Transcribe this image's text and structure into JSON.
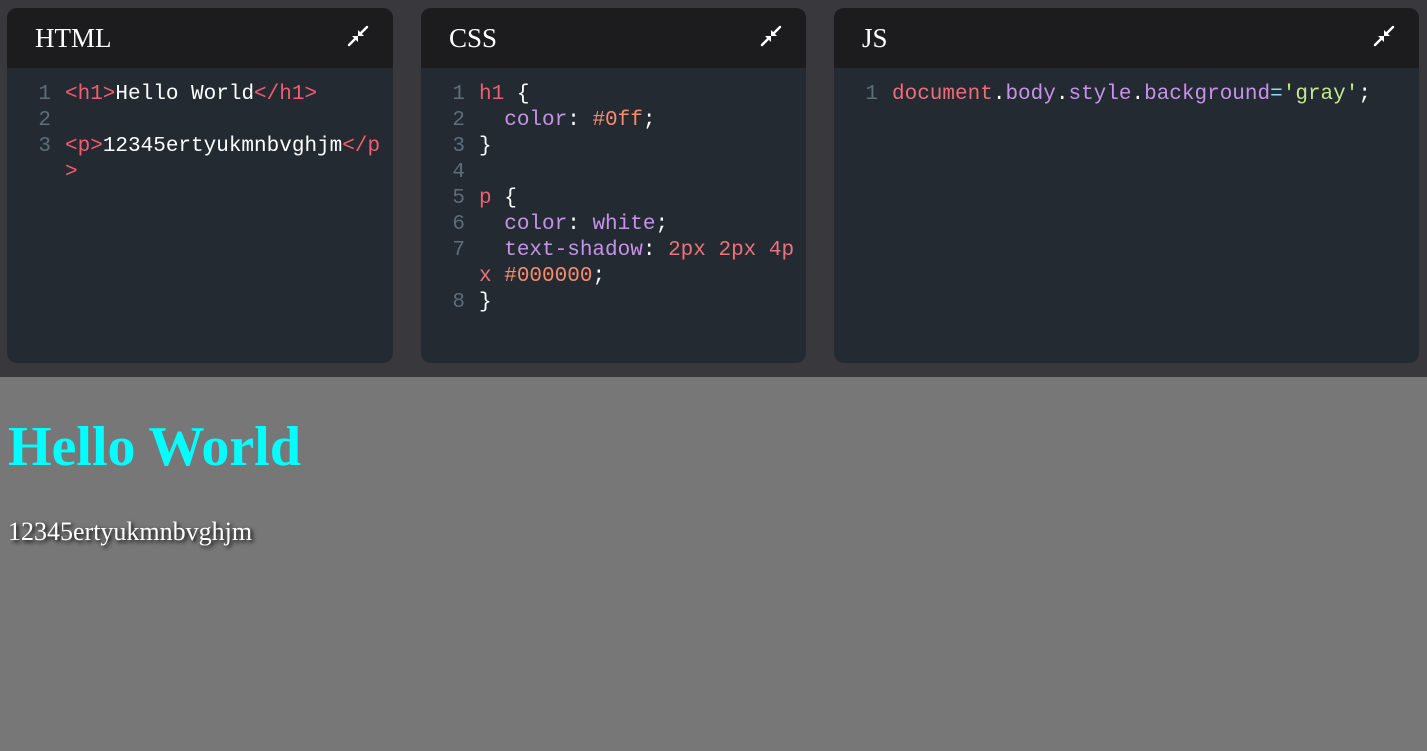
{
  "panels": [
    {
      "title": "HTML",
      "lines": [
        {
          "num": "1",
          "tokens": [
            {
              "t": "<h1>",
              "c": "tag"
            },
            {
              "t": "Hello World",
              "c": "plain"
            },
            {
              "t": "</h1>",
              "c": "tag"
            }
          ]
        },
        {
          "num": "2",
          "tokens": []
        },
        {
          "num": "3",
          "tokens": [
            {
              "t": "<p>",
              "c": "tag"
            },
            {
              "t": "12345ertyukmnbvghjm",
              "c": "plain"
            },
            {
              "t": "</p>",
              "c": "tag"
            }
          ]
        }
      ]
    },
    {
      "title": "CSS",
      "lines": [
        {
          "num": "1",
          "tokens": [
            {
              "t": "h1",
              "c": "sel"
            },
            {
              "t": " {",
              "c": "plain"
            }
          ]
        },
        {
          "num": "2",
          "tokens": [
            {
              "t": "  color",
              "c": "prop"
            },
            {
              "t": ": ",
              "c": "plain"
            },
            {
              "t": "#0ff",
              "c": "hex"
            },
            {
              "t": ";",
              "c": "plain"
            }
          ]
        },
        {
          "num": "3",
          "tokens": [
            {
              "t": "}",
              "c": "plain"
            }
          ]
        },
        {
          "num": "4",
          "tokens": []
        },
        {
          "num": "5",
          "tokens": [
            {
              "t": "p",
              "c": "sel"
            },
            {
              "t": " {",
              "c": "plain"
            }
          ]
        },
        {
          "num": "6",
          "tokens": [
            {
              "t": "  color",
              "c": "prop"
            },
            {
              "t": ": ",
              "c": "plain"
            },
            {
              "t": "white",
              "c": "prop"
            },
            {
              "t": ";",
              "c": "plain"
            }
          ]
        },
        {
          "num": "7",
          "tokens": [
            {
              "t": "  text-shadow",
              "c": "prop"
            },
            {
              "t": ": ",
              "c": "plain"
            },
            {
              "t": "2px 2px 4px",
              "c": "num"
            },
            {
              "t": " ",
              "c": "plain"
            },
            {
              "t": "#000000",
              "c": "hex"
            },
            {
              "t": ";",
              "c": "plain"
            }
          ]
        },
        {
          "num": "8",
          "tokens": [
            {
              "t": "}",
              "c": "plain"
            }
          ]
        }
      ]
    },
    {
      "title": "JS",
      "lines": [
        {
          "num": "1",
          "tokens": [
            {
              "t": "document",
              "c": "var"
            },
            {
              "t": ".",
              "c": "plain"
            },
            {
              "t": "body",
              "c": "prop"
            },
            {
              "t": ".",
              "c": "plain"
            },
            {
              "t": "style",
              "c": "prop"
            },
            {
              "t": ".",
              "c": "plain"
            },
            {
              "t": "background",
              "c": "prop"
            },
            {
              "t": "=",
              "c": "op"
            },
            {
              "t": "'gray'",
              "c": "str"
            },
            {
              "t": ";",
              "c": "plain"
            }
          ]
        }
      ]
    }
  ],
  "collapse_icon": "collapse-arrows-icon",
  "preview": {
    "heading": "Hello World",
    "paragraph": "12345ertyukmnbvghjm",
    "background": "#777777",
    "heading_color": "#00ffff"
  }
}
